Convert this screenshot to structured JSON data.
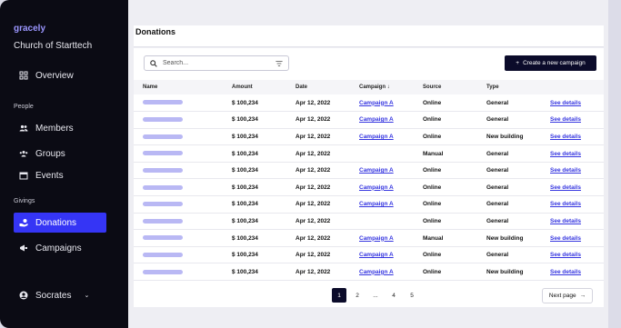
{
  "app": {
    "logo": "gracely",
    "organization": "Church of Starttech"
  },
  "sidebar": {
    "overview": "Overview",
    "people_section": "People",
    "people": [
      {
        "label": "Members",
        "icon": "members-icon"
      },
      {
        "label": "Groups",
        "icon": "groups-icon"
      },
      {
        "label": "Events",
        "icon": "calendar-icon"
      }
    ],
    "givings_section": "Givings",
    "givings": [
      {
        "label": "Donations",
        "icon": "donations-icon",
        "active": true
      },
      {
        "label": "Campaigns",
        "icon": "campaigns-icon"
      }
    ],
    "user": {
      "name": "Socrates",
      "caret": "⌄"
    }
  },
  "page": {
    "title": "Donations",
    "search_placeholder": "Search...",
    "create_button": "Create a new campaign",
    "create_button_icon": "+"
  },
  "table": {
    "columns": [
      "Name",
      "Amount",
      "Date",
      "Campaign ↓",
      "Source",
      "Type"
    ],
    "rows": [
      {
        "amount": "$ 100,234",
        "date": "Apr 12, 2022",
        "campaign": "Campaign A",
        "source": "Online",
        "type": "General",
        "action": "See details"
      },
      {
        "amount": "$ 100,234",
        "date": "Apr 12, 2022",
        "campaign": "Campaign A",
        "source": "Online",
        "type": "General",
        "action": "See details"
      },
      {
        "amount": "$ 100,234",
        "date": "Apr 12, 2022",
        "campaign": "Campaign A",
        "source": "Online",
        "type": "New building",
        "action": "See details"
      },
      {
        "amount": "$ 100,234",
        "date": "Apr 12, 2022",
        "campaign": "",
        "source": "Manual",
        "type": "General",
        "action": "See details"
      },
      {
        "amount": "$ 100,234",
        "date": "Apr 12, 2022",
        "campaign": "Campaign A",
        "source": "Online",
        "type": "General",
        "action": "See details"
      },
      {
        "amount": "$ 100,234",
        "date": "Apr 12, 2022",
        "campaign": "Campaign A",
        "source": "Online",
        "type": "General",
        "action": "See details"
      },
      {
        "amount": "$ 100,234",
        "date": "Apr 12, 2022",
        "campaign": "Campaign A",
        "source": "Online",
        "type": "General",
        "action": "See details"
      },
      {
        "amount": "$ 100,234",
        "date": "Apr 12, 2022",
        "campaign": "",
        "source": "Online",
        "type": "General",
        "action": "See details"
      },
      {
        "amount": "$ 100,234",
        "date": "Apr 12, 2022",
        "campaign": "Campaign A",
        "source": "Manual",
        "type": "New building",
        "action": "See details"
      },
      {
        "amount": "$ 100,234",
        "date": "Apr 12, 2022",
        "campaign": "Campaign A",
        "source": "Online",
        "type": "General",
        "action": "See details"
      },
      {
        "amount": "$ 100,234",
        "date": "Apr 12, 2022",
        "campaign": "Campaign A",
        "source": "Online",
        "type": "New building",
        "action": "See details"
      }
    ]
  },
  "pagination": {
    "pages": [
      "1",
      "2",
      "...",
      "4",
      "5"
    ],
    "current": "1",
    "next_label": "Next page",
    "next_icon": "→"
  },
  "colors": {
    "accent": "#3535f5",
    "sidebar_bg": "#0b0b14",
    "link": "#3535e0",
    "dark_button": "#0b0b2a"
  }
}
